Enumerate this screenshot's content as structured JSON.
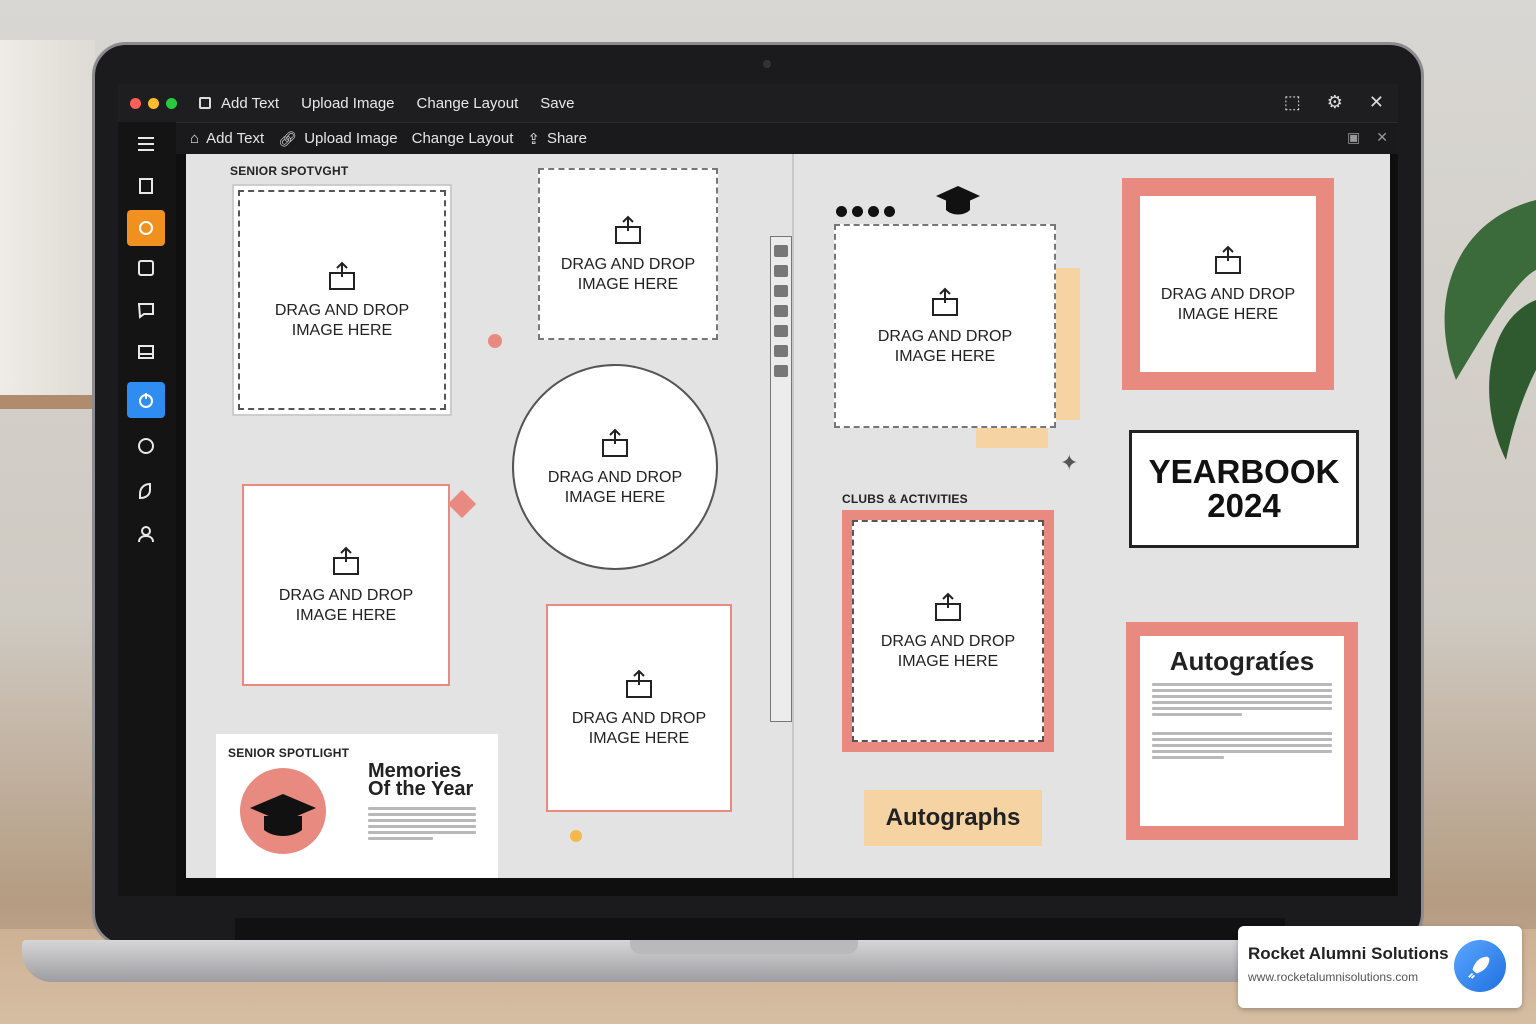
{
  "menubar": {
    "items": [
      "Add Text",
      "Upload Image",
      "Change Layout",
      "Save"
    ],
    "window_icons": [
      "share-icon",
      "settings-icon",
      "close-icon"
    ]
  },
  "toolbar": {
    "items": [
      "Add Text",
      "Upload Image",
      "Change Layout",
      "Share"
    ]
  },
  "sidebar": {
    "icons": [
      "menu-icon",
      "pages-icon",
      "refresh-icon",
      "frame-icon",
      "comment-icon",
      "library-icon",
      "power-icon",
      "help-icon",
      "sticker-icon",
      "user-icon"
    ],
    "active_orange": 2,
    "active_blue": 6
  },
  "canvas": {
    "label_senior_spotlight_top": "SENIOR SPOTVGHT",
    "label_clubs": "CLUBS & ACTIVITIES",
    "dropzone_text_line1": "DRAG AND DROP",
    "dropzone_text_line2": "IMAGE HERE",
    "yearbook_line1": "YEARBOOK",
    "yearbook_line2": "2024",
    "autographs_sticky": "Autographs",
    "autographs_card_title": "Autogratíes",
    "spotlight_card": {
      "label": "SENIOR SPOTLIGHT",
      "title_line1": "Memories",
      "title_line2": "Of the Year"
    }
  },
  "badge": {
    "name": "Rocket Alumni Solutions",
    "url": "www.rocketalumnisolutions.com"
  },
  "colors": {
    "accent_orange": "#f0901f",
    "accent_blue": "#2f8cf0",
    "salmon": "#e88a80",
    "sticky": "#f5d3a3"
  }
}
